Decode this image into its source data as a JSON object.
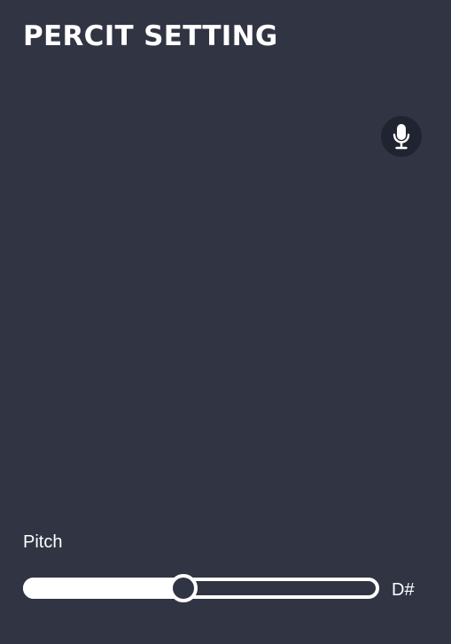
{
  "header": {
    "title": "PERCIT SETTING"
  },
  "mic_button": {
    "icon": "microphone-icon"
  },
  "pitch": {
    "label": "Pitch",
    "value_label": "D#",
    "level_fraction": 0.45
  },
  "colors": {
    "background": "#303443",
    "mic_button_background": "#202431",
    "foreground": "#ffffff"
  }
}
